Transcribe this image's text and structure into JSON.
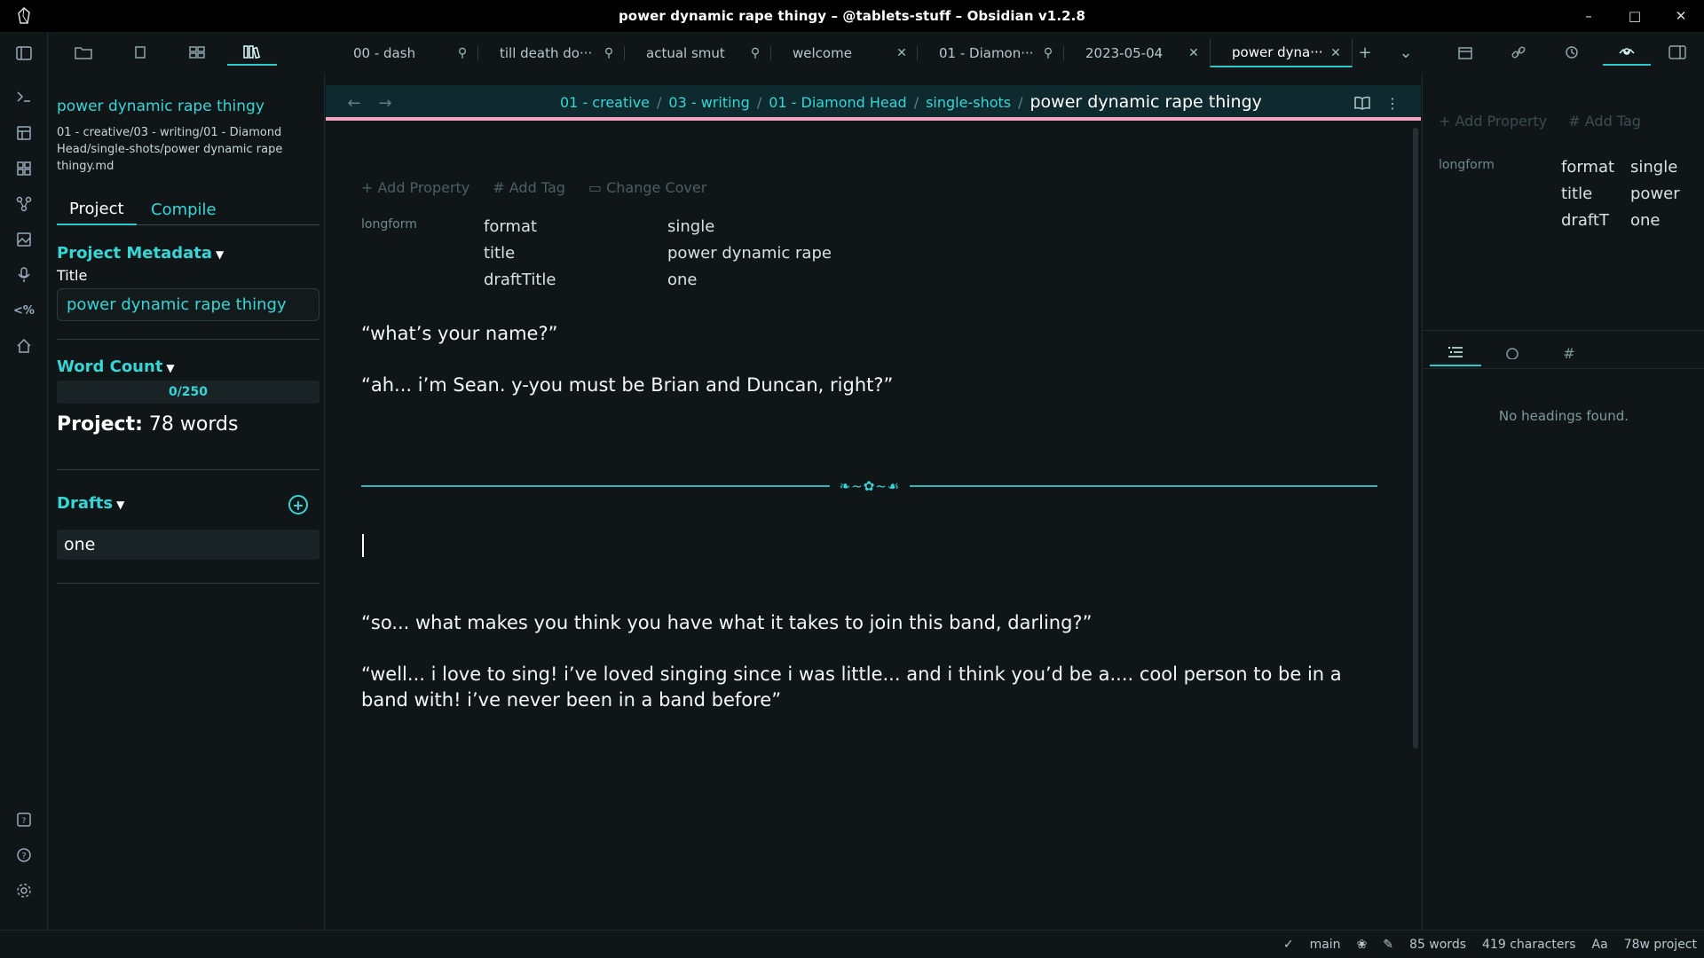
{
  "window": {
    "title": "power dynamic rape thingy – @tablets-stuff – Obsidian v1.2.8",
    "minimize": "–",
    "maximize": "□",
    "close": "✕"
  },
  "tabs": [
    {
      "label": "00 - dash",
      "icon": "pin-icon"
    },
    {
      "label": "till death do···",
      "icon": "pin-icon"
    },
    {
      "label": "actual smut",
      "icon": "pin-icon"
    },
    {
      "label": "welcome",
      "icon": "close-icon"
    },
    {
      "label": "01 - Diamon···",
      "icon": "pin-icon"
    },
    {
      "label": "2023-05-04",
      "icon": "close-icon"
    },
    {
      "label": "power dyna···",
      "icon": "close-icon",
      "active": true
    }
  ],
  "left_panel": {
    "project_title": "power dynamic rape thingy",
    "project_path": "01 - creative/03 - writing/01 - Diamond Head/single-shots/power dynamic rape thingy.md",
    "tab_project": "Project",
    "tab_compile": "Compile",
    "metadata_heading": "Project Metadata",
    "title_label": "Title",
    "title_value": "power dynamic rape thingy",
    "word_count_heading": "Word Count",
    "word_goal": "0/250",
    "project_label": "Project:",
    "project_words": "78 words",
    "drafts_heading": "Drafts",
    "drafts": [
      "one"
    ]
  },
  "editor": {
    "breadcrumbs": [
      "01 - creative",
      "03 - writing",
      "01 - Diamond Head",
      "single-shots"
    ],
    "breadcrumb_current": "power dynamic rape thingy",
    "add_property": "+ Add Property",
    "add_tag": "# Add Tag",
    "change_cover": "Change Cover",
    "property_group": "longform",
    "properties": [
      {
        "key": "format",
        "value": "single"
      },
      {
        "key": "title",
        "value": "power dynamic rape thi"
      },
      {
        "key": "draftTitle",
        "value": "one"
      }
    ],
    "paragraphs_before": [
      "“what’s your name?”",
      "“ah... i’m Sean. y-you must be Brian and Duncan, right?”"
    ],
    "divider_ornament": "❧~✿~☙",
    "paragraphs_after": [
      "“so... what makes you think you have what it takes to join this band, darling?”",
      "“well... i love to sing! i’ve loved singing since i was little... and i think you’d be a.... cool person to be in a band with! i’ve never been in a band before”"
    ]
  },
  "right_panel": {
    "add_property": "+ Add Property",
    "add_tag": "# Add Tag",
    "property_group": "longform",
    "properties": [
      {
        "key": "format",
        "value": "single"
      },
      {
        "key": "title",
        "value": "power d"
      },
      {
        "key": "draftT",
        "value": "one"
      }
    ],
    "empty_message": "No headings found."
  },
  "status_bar": {
    "branch": "main",
    "words": "85 words",
    "characters": "419 characters",
    "font": "Aa",
    "project": "78w project"
  },
  "colors": {
    "accent": "#2bc9c9",
    "link": "#36d6d6",
    "background": "#101618",
    "nav_underline": "#f5a6c0"
  }
}
